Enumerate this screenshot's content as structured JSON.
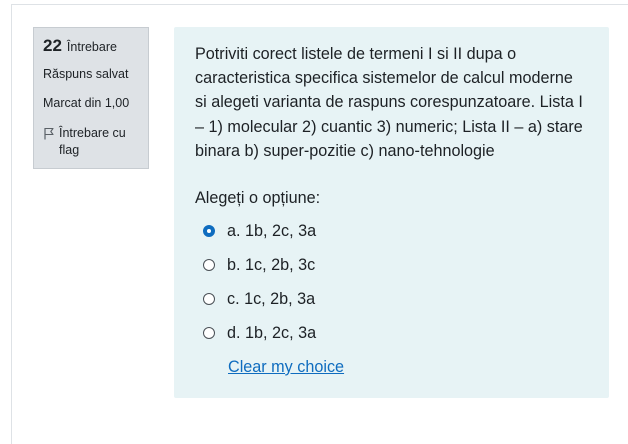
{
  "question_info": {
    "number": "22",
    "label": "Întrebare",
    "status": "Răspuns salvat",
    "marked_out_of": "Marcat din 1,00",
    "flag_label": "Întrebare cu flag"
  },
  "question": {
    "text": "Potriviti corect listele de termeni I si II dupa o caracteristica specifica sistemelor de calcul moderne si alegeti varianta de raspuns corespunzatoare. Lista I – 1) molecular 2) cuantic 3) numeric; Lista II – a) stare binara b) super-pozitie c) nano-tehnologie",
    "prompt": "Alegeți o opțiune:",
    "options": [
      {
        "label": "a. 1b, 2c, 3a",
        "selected": true
      },
      {
        "label": "b. 1c, 2b, 3c",
        "selected": false
      },
      {
        "label": "c. 1c, 2b, 3a",
        "selected": false
      },
      {
        "label": "d. 1b, 2c, 3a",
        "selected": false
      }
    ],
    "clear_label": "Clear my choice"
  },
  "colors": {
    "info_bg": "#dee2e6",
    "content_bg": "#e7f3f5",
    "link": "#0f6cbf",
    "radio_selected": "#0f6cbf"
  },
  "icons": {
    "flag": "flag-icon"
  }
}
